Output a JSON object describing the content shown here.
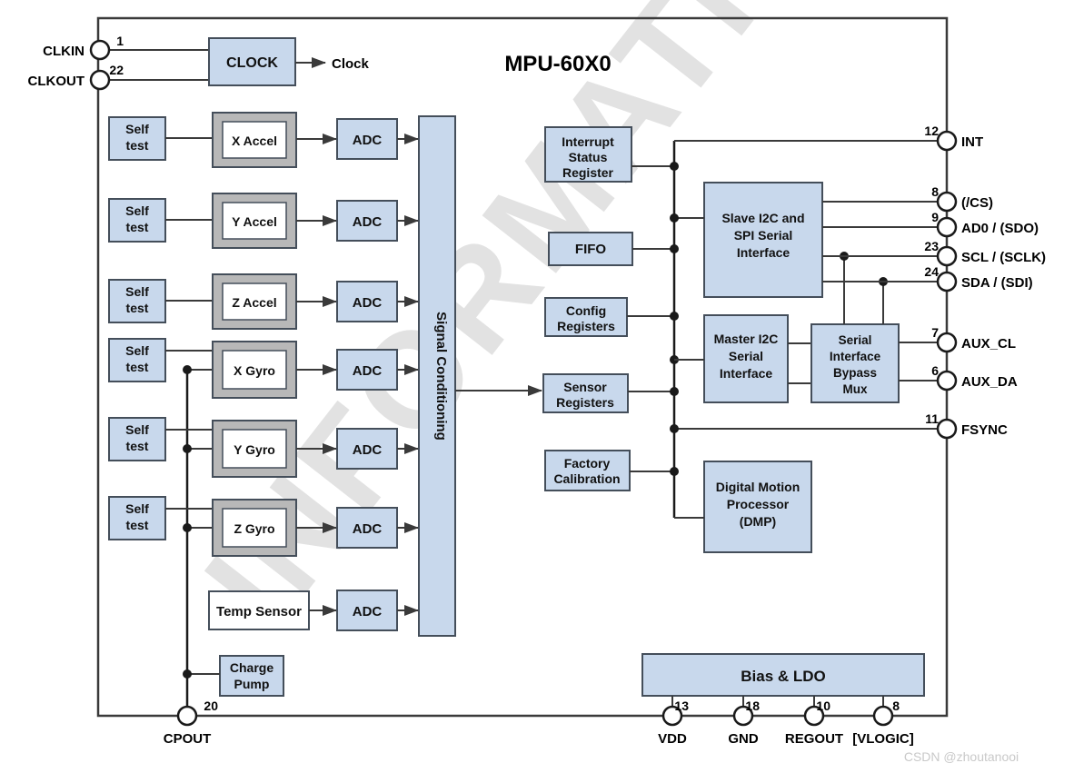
{
  "title": "MPU-60X0",
  "watermark": {
    "text": "INFORMATION",
    "credit": "CSDN @zhoutanooi"
  },
  "colors": {
    "block_fill": "#c8d8ec",
    "block_stroke": "#444e5a",
    "sensor_shell_fill": "#b8b8b8",
    "sensor_core_fill": "#ffffff",
    "wire": "#3a3a3a",
    "boundary": "#3a3a3a",
    "text": "#111111",
    "watermark": "#d8d8d8"
  },
  "clock": {
    "block_label": "CLOCK",
    "output_label": "Clock"
  },
  "selftest_label": "Self\ntest",
  "adc_label": "ADC",
  "signal_conditioning_label": "Signal Conditioning",
  "accel_blocks": [
    {
      "label": "X Accel"
    },
    {
      "label": "Y Accel"
    },
    {
      "label": "Z Accel"
    }
  ],
  "gyro_blocks": [
    {
      "label": "X Gyro"
    },
    {
      "label": "Y Gyro"
    },
    {
      "label": "Z Gyro"
    }
  ],
  "temp_sensor_label": "Temp Sensor",
  "charge_pump_label": "Charge\nPump",
  "register_blocks": [
    {
      "id": "interrupt-status-register",
      "label": "Interrupt\nStatus\nRegister"
    },
    {
      "id": "fifo",
      "label": "FIFO"
    },
    {
      "id": "config-registers",
      "label": "Config\nRegisters"
    },
    {
      "id": "sensor-registers",
      "label": "Sensor\nRegisters"
    },
    {
      "id": "factory-calibration",
      "label": "Factory\nCalibration"
    }
  ],
  "interface_blocks": [
    {
      "id": "slave-i2c-spi-serial-interface",
      "label": "Slave I2C and\nSPI Serial\nInterface"
    },
    {
      "id": "master-i2c-serial-interface",
      "label": "Master I2C\nSerial\nInterface"
    },
    {
      "id": "serial-interface-bypass-mux",
      "label": "Serial\nInterface\nBypass\nMux"
    },
    {
      "id": "digital-motion-processor",
      "label": "Digital Motion\nProcessor\n(DMP)"
    }
  ],
  "bias_ldo_label": "Bias & LDO",
  "left_pins": [
    {
      "name": "CLKIN",
      "number": "1"
    },
    {
      "name": "CLKOUT",
      "number": "22"
    }
  ],
  "right_pins": [
    {
      "name": "INT",
      "number": "12"
    },
    {
      "name": "(/CS)",
      "number": "8"
    },
    {
      "name": "AD0 / (SDO)",
      "number": "9"
    },
    {
      "name": "SCL / (SCLK)",
      "number": "23"
    },
    {
      "name": "SDA / (SDI)",
      "number": "24"
    },
    {
      "name": "AUX_CL",
      "number": "7"
    },
    {
      "name": "AUX_DA",
      "number": "6"
    },
    {
      "name": "FSYNC",
      "number": "11"
    }
  ],
  "bottom_pins": [
    {
      "name": "CPOUT",
      "number": "20"
    },
    {
      "name": "VDD",
      "number": "13"
    },
    {
      "name": "GND",
      "number": "18"
    },
    {
      "name": "REGOUT",
      "number": "10"
    },
    {
      "name": "[VLOGIC]",
      "number": "8"
    }
  ]
}
